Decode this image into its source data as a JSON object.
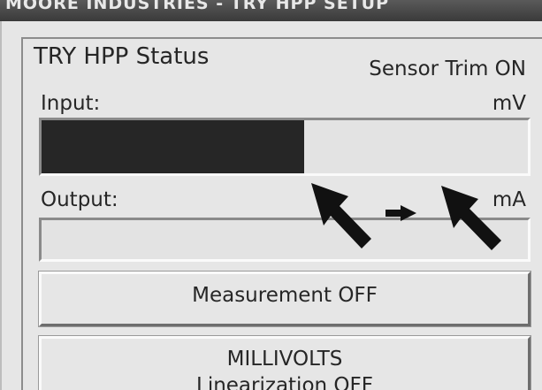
{
  "window": {
    "title": "MOORE INDUSTRIES - TRY HPP SETUP"
  },
  "status_group": {
    "title": "TRY HPP Status",
    "sensor_trim": "Sensor Trim ON",
    "input": {
      "label": "Input:",
      "unit": "mV",
      "level": 0.54
    },
    "output": {
      "label": "Output:",
      "unit": "mA",
      "level": 0
    },
    "measurement_button": {
      "label": "Measurement OFF"
    },
    "mode_button": {
      "line1": "MILLIVOLTS",
      "line2": "Linearization OFF"
    }
  },
  "annotation": {
    "arrow_color": "#111111"
  }
}
